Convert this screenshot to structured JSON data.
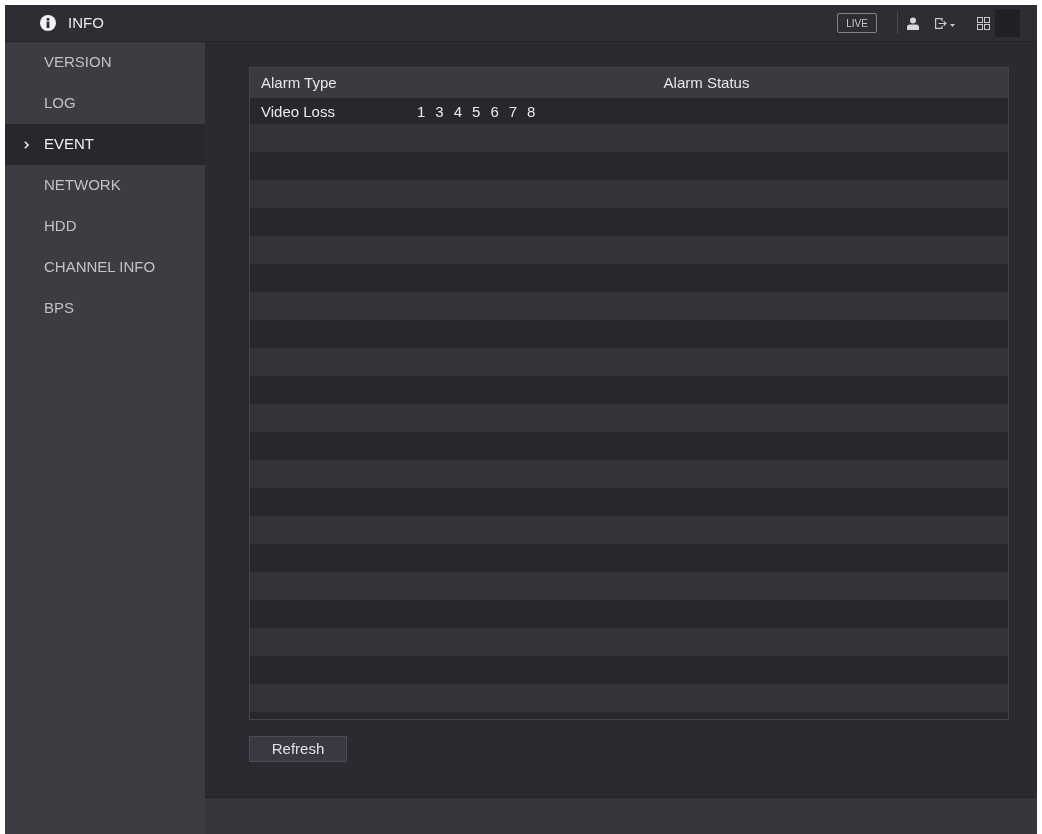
{
  "window": {
    "title": "INFO"
  },
  "toolbar": {
    "live_button": "LIVE"
  },
  "sidebar": {
    "items": [
      {
        "label": "VERSION",
        "selected": false
      },
      {
        "label": "LOG",
        "selected": false
      },
      {
        "label": "EVENT",
        "selected": true
      },
      {
        "label": "NETWORK",
        "selected": false
      },
      {
        "label": "HDD",
        "selected": false
      },
      {
        "label": "CHANNEL INFO",
        "selected": false
      },
      {
        "label": "BPS",
        "selected": false
      }
    ]
  },
  "table": {
    "columns": [
      "Alarm Type",
      "Alarm Status"
    ],
    "rows": [
      {
        "alarm_type": "Video Loss",
        "alarm_status": [
          "1",
          "3",
          "4",
          "5",
          "6",
          "7",
          "8"
        ]
      }
    ]
  },
  "buttons": [
    "Refresh"
  ]
}
